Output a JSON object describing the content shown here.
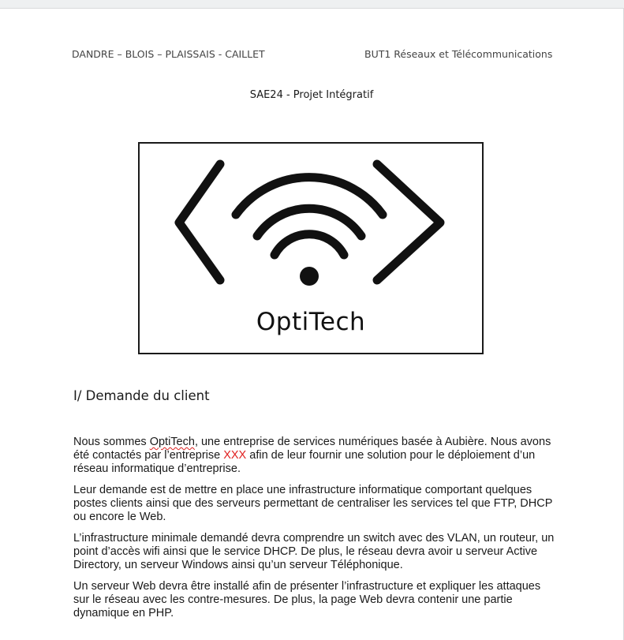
{
  "header": {
    "authors": "DANDRE – BLOIS – PLAISSAIS - CAILLET",
    "program": "BUT1 Réseaux et Télécommunications"
  },
  "subtitle": "SAE24 - Projet Intégratif",
  "logo": {
    "name": "OptiTech",
    "icon": "wifi-code-brackets-icon"
  },
  "section": {
    "title": "I/ Demande du client"
  },
  "paragraphs": {
    "p1": {
      "a": "Nous sommes ",
      "b": "OptiTech",
      "c": ", une entreprise de services numériques basée à Aubière.  Nous avons été contactés par l’entreprise ",
      "d": "XXX",
      "e": " afin de leur fournir une solution pour le déploiement d’un réseau informatique d’entreprise."
    },
    "p2": "Leur demande est de mettre en place une infrastructure informatique comportant quelques postes clients ainsi que des serveurs permettant de centraliser les services tel que FTP, DHCP ou encore le Web.",
    "p3": "L’infrastructure minimale demandé devra comprendre un switch avec des VLAN, un routeur, un point d’accès wifi ainsi que le service DHCP. De plus, le réseau devra avoir u serveur Active Directory, un serveur Windows ainsi qu’un serveur Téléphonique.",
    "p4": "Un serveur Web devra être installé afin de présenter l’infrastructure et expliquer les attaques sur le réseau avec les contre-mesures. De plus, la page Web devra contenir une partie dynamique en PHP."
  },
  "colors": {
    "highlight": "#e02020",
    "spellcheck": "#dd2222",
    "text": "#1a1a1a"
  }
}
